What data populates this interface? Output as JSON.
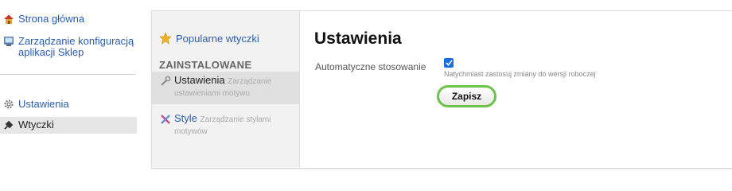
{
  "leftnav": {
    "home_label": "Strona główna",
    "config_label": "Zarządzanie konfiguracją aplikacji Sklep",
    "settings_label": "Ustawienia",
    "plugins_label": "Wtyczki"
  },
  "subnav": {
    "popular_label": "Popularne wtyczki",
    "installed_heading": "ZAINSTALOWANE",
    "plugins": [
      {
        "name": "Ustawienia",
        "description": "Zarządzanie ustawieniami motywu",
        "selected": true
      },
      {
        "name": "Style",
        "description": "Zarządzanie stylami motywów",
        "selected": false
      }
    ]
  },
  "main": {
    "title": "Ustawienia",
    "field_label": "Automatyczne stosowanie",
    "field_checked": true,
    "field_hint": "Natychmiast zastosuj zmiany do wersji roboczej",
    "save_label": "Zapisz"
  },
  "colors": {
    "link": "#2a5db0",
    "button_border": "#6cc24a",
    "checkbox": "#1a6fde"
  },
  "icons": {
    "home": "home-icon",
    "config": "config-icon",
    "settings": "gear-icon",
    "plugins": "plugin-icon",
    "popular": "star-icon",
    "plugin_settings": "wrench-icon",
    "plugin_style": "paint-icon"
  }
}
